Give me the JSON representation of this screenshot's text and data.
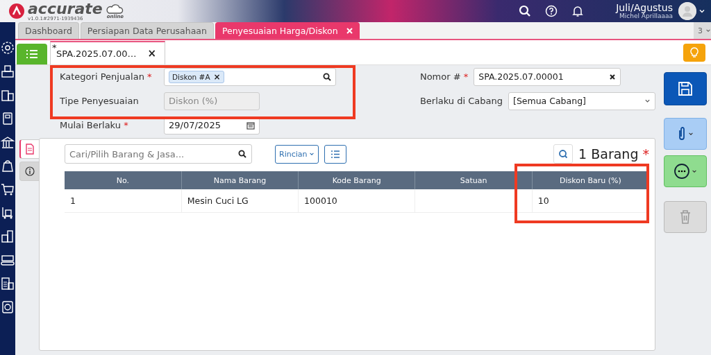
{
  "header": {
    "logo_text": "accurate",
    "logo_sub": "online",
    "version": "v1.0.1#2971-1939436",
    "period": "Juli/Agustus",
    "user": "Michel Aprillaaaa"
  },
  "tabs": [
    {
      "label": "Dashboard",
      "selected": false
    },
    {
      "label": "Persiapan Data Perusahaan",
      "selected": false
    },
    {
      "label": "Penyesuaian Harga/Diskon",
      "selected": true
    }
  ],
  "tab_count": "3",
  "subtab": {
    "label": "SPA.2025.07.00…",
    "modified_mark": "*",
    "close": "×"
  },
  "required_mark": "*",
  "left_fields": [
    {
      "label": "Kategori Penjualan",
      "required": true,
      "kind": "tag",
      "tag": "Diskon #A",
      "tag_remove": "×"
    },
    {
      "label": "Tipe Penyesuaian",
      "required": false,
      "kind": "readonly",
      "placeholder": "Diskon (%)"
    },
    {
      "label": "Mulai Berlaku",
      "required": true,
      "kind": "date",
      "value": "29/07/2025"
    }
  ],
  "right_fields": [
    {
      "label": "Nomor #",
      "required": true,
      "kind": "clearable",
      "value": "SPA.2025.07.00001"
    },
    {
      "label": "Berlaku di Cabang",
      "required": false,
      "kind": "select",
      "value": "[Semua Cabang]"
    }
  ],
  "side_tabs": [
    {
      "kind": "document",
      "selected": true
    },
    {
      "kind": "info",
      "selected": false
    }
  ],
  "items": {
    "search_placeholder": "Cari/Pilih Barang & Jasa...",
    "detail_button": "Rincian",
    "count": "1 Barang",
    "count_required": true
  },
  "table": {
    "columns": [
      "No.",
      "Nama Barang",
      "Kode Barang",
      "Satuan",
      "Diskon Baru (%)"
    ],
    "rows": [
      {
        "cells": [
          "1",
          "Mesin Cuci LG",
          "100010",
          null,
          "10"
        ]
      }
    ]
  }
}
